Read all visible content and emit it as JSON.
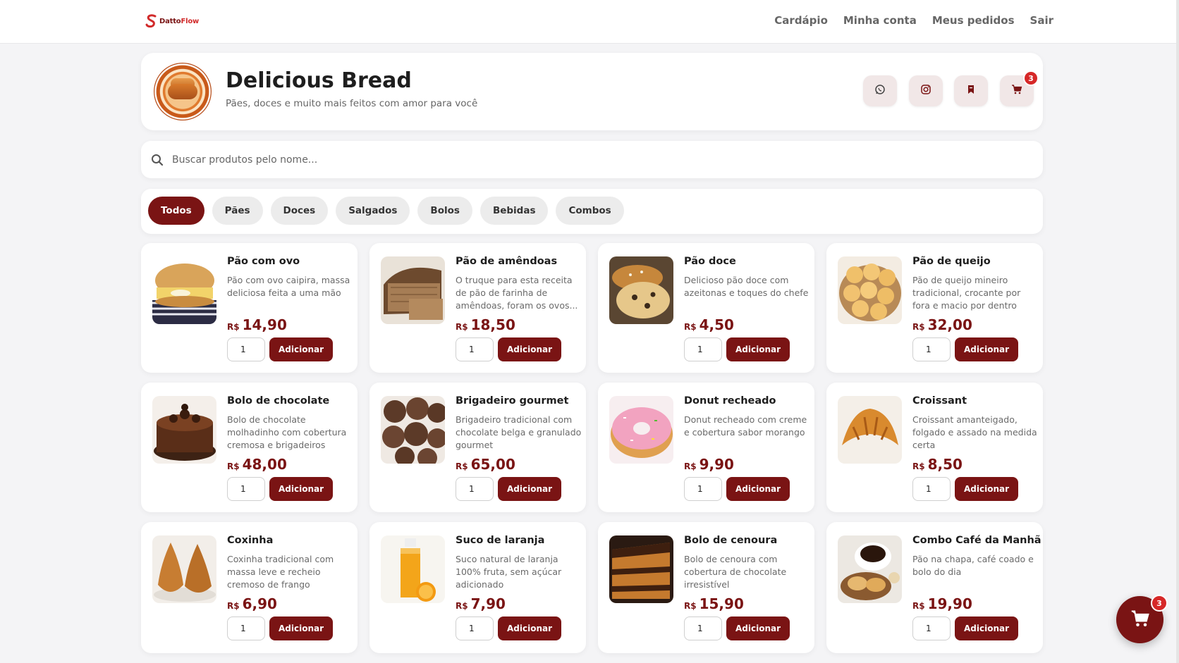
{
  "navbar": {
    "logo_text_a": "Datto",
    "logo_text_b": "Flow",
    "links": [
      "Cardápio",
      "Minha conta",
      "Meus pedidos",
      "Sair"
    ]
  },
  "header": {
    "title": "Delicious Bread",
    "subtitle": "Pães, doces e muito mais feitos com amor para você",
    "buttons": [
      "whatsapp-icon",
      "instagram-icon",
      "bookmark-icon",
      "cart-icon"
    ],
    "cart_count": "3"
  },
  "search": {
    "placeholder": "Buscar produtos pelo nome..."
  },
  "categories": [
    "Todos",
    "Pães",
    "Doces",
    "Salgados",
    "Bolos",
    "Bebidas",
    "Combos"
  ],
  "active_category": "Todos",
  "currency": "R$",
  "add_label": "Adicionar",
  "products": [
    {
      "name": "Pão com ovo",
      "desc": "Pão com ovo caipira, massa deliciosa feita a uma mão",
      "price": "14,90",
      "qty": "1"
    },
    {
      "name": "Pão de amêndoas",
      "desc": "O truque para esta receita de pão de farinha de amêndoas, foram os ovos...",
      "price": "18,50",
      "qty": "1"
    },
    {
      "name": "Pão doce",
      "desc": "Delicioso pão doce com azeitonas e toques do chefe",
      "price": "4,50",
      "qty": "1"
    },
    {
      "name": "Pão de queijo",
      "desc": "Pão de queijo mineiro tradicional, crocante por fora e macio por dentro",
      "price": "32,00",
      "qty": "1"
    },
    {
      "name": "Bolo de chocolate",
      "desc": "Bolo de chocolate molhadinho com cobertura cremosa e brigadeiros",
      "price": "48,00",
      "qty": "1"
    },
    {
      "name": "Brigadeiro gourmet",
      "desc": "Brigadeiro tradicional com chocolate belga e granulado gourmet",
      "price": "65,00",
      "qty": "1"
    },
    {
      "name": "Donut recheado",
      "desc": "Donut recheado com creme e cobertura sabor morango",
      "price": "9,90",
      "qty": "1"
    },
    {
      "name": "Croissant",
      "desc": "Croissant amanteigado, folgado e assado na medida certa",
      "price": "8,50",
      "qty": "1"
    },
    {
      "name": "Coxinha",
      "desc": "Coxinha tradicional com massa leve e recheio cremoso de frango",
      "price": "6,90",
      "qty": "1"
    },
    {
      "name": "Suco de laranja",
      "desc": "Suco natural de laranja 100% fruta, sem açúcar adicionado",
      "price": "7,90",
      "qty": "1"
    },
    {
      "name": "Bolo de cenoura",
      "desc": "Bolo de cenoura com cobertura de chocolate irresistível",
      "price": "15,90",
      "qty": "1"
    },
    {
      "name": "Combo Café da Manhã",
      "desc": "Pão na chapa, café coado e bolo do dia",
      "price": "19,90",
      "qty": "1"
    }
  ],
  "floating_cart": {
    "icon": "cart-icon",
    "count": "3"
  },
  "colors": {
    "accent": "#7a1414",
    "badge": "#d62828",
    "background": "#f4f4f6"
  }
}
